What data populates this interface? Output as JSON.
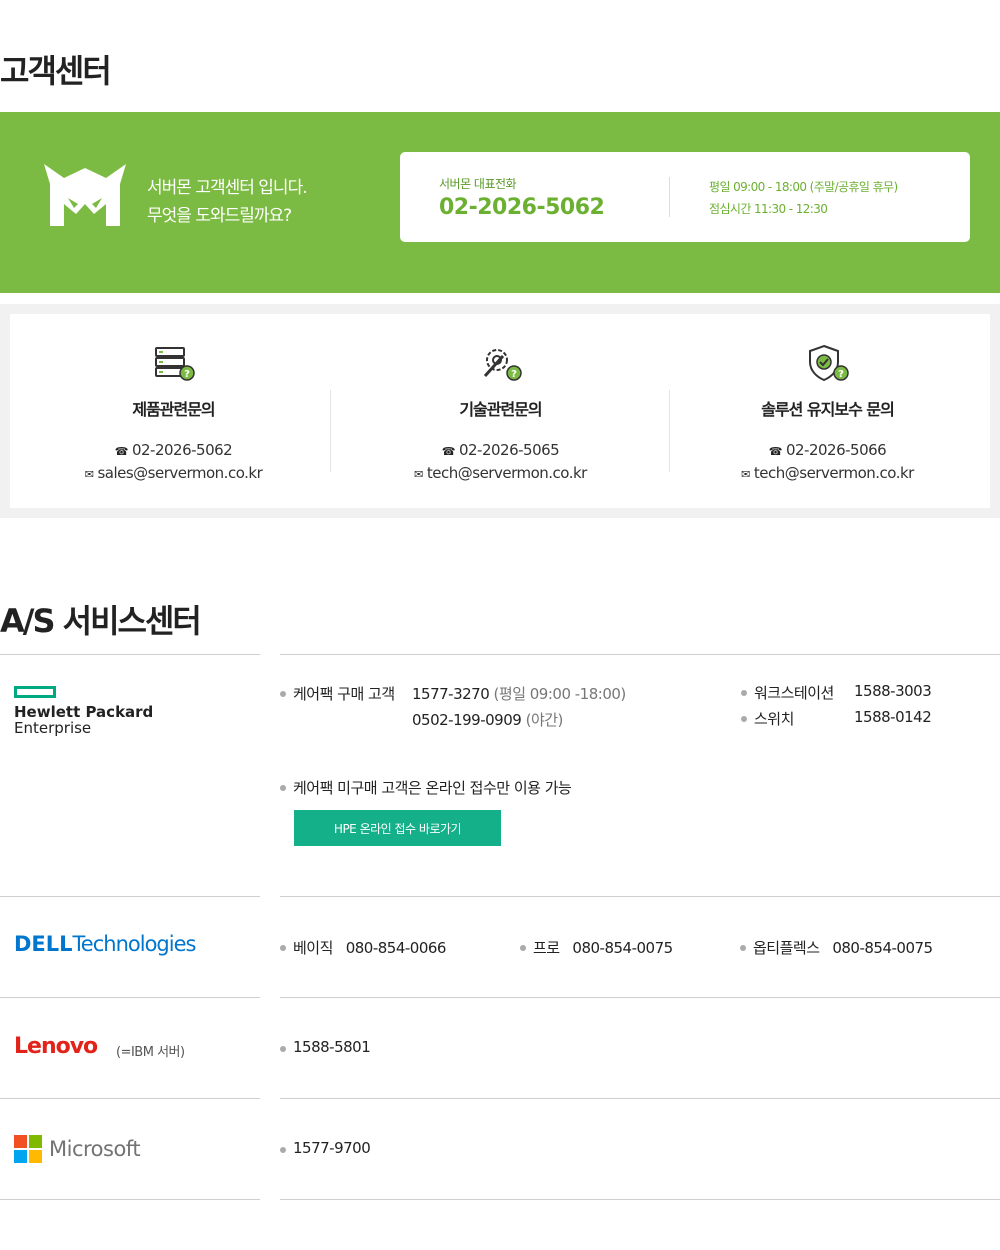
{
  "customer_center": {
    "title": "고객센터",
    "greeting_line1": "서버몬 고객센터 입니다.",
    "greeting_line2": "무엇을 도와드릴까요?",
    "main_phone_label": "서버몬 대표전화",
    "main_phone": "02-2026-5062",
    "hours_line1": "평일 09:00 - 18:00 (주말/공휴일 휴무)",
    "hours_line2": "점심시간 11:30 - 12:30",
    "brand_color": "#7cbb43"
  },
  "inquiries": [
    {
      "icon": "server-question-icon",
      "title": "제품관련문의",
      "phone": "02-2026-5062",
      "email": "sales@servermon.co.kr"
    },
    {
      "icon": "gear-wrench-question-icon",
      "title": "기술관련문의",
      "phone": "02-2026-5065",
      "email": "tech@servermon.co.kr"
    },
    {
      "icon": "shield-check-question-icon",
      "title": "솔루션 유지보수 문의",
      "phone": "02-2026-5066",
      "email": "tech@servermon.co.kr"
    }
  ],
  "as_center": {
    "title": "A/S 서비스센터",
    "hpe": {
      "logo_line1": "Hewlett Packard",
      "logo_line2": "Enterprise",
      "carepack_buyer_label": "케어팩 구매 고객",
      "carepack_phone1": "1577-3270",
      "carepack_phone1_note": "(평일 09:00 -18:00)",
      "carepack_phone2": "0502-199-0909",
      "carepack_phone2_note": "(야간)",
      "workstation_label": "워크스테이션",
      "workstation_phone": "1588-3003",
      "switch_label": "스위치",
      "switch_phone": "1588-0142",
      "non_buyer_text": "케어팩 미구매 고객은  온라인 접수만 이용 가능",
      "online_button": "HPE 온라인 접수 바로가기",
      "button_color": "#14b08a"
    },
    "dell": {
      "logo_brand": "DELL",
      "logo_suffix": "Technologies",
      "items": [
        {
          "label": "베이직",
          "phone": "080-854-0066"
        },
        {
          "label": "프로",
          "phone": "080-854-0075"
        },
        {
          "label": "옵티플렉스",
          "phone": "080-854-0075"
        }
      ]
    },
    "lenovo": {
      "logo": "Lenovo",
      "note": "(=IBM 서버)",
      "phone": "1588-5801"
    },
    "microsoft": {
      "logo": "Microsoft",
      "phone": "1577-9700"
    }
  }
}
